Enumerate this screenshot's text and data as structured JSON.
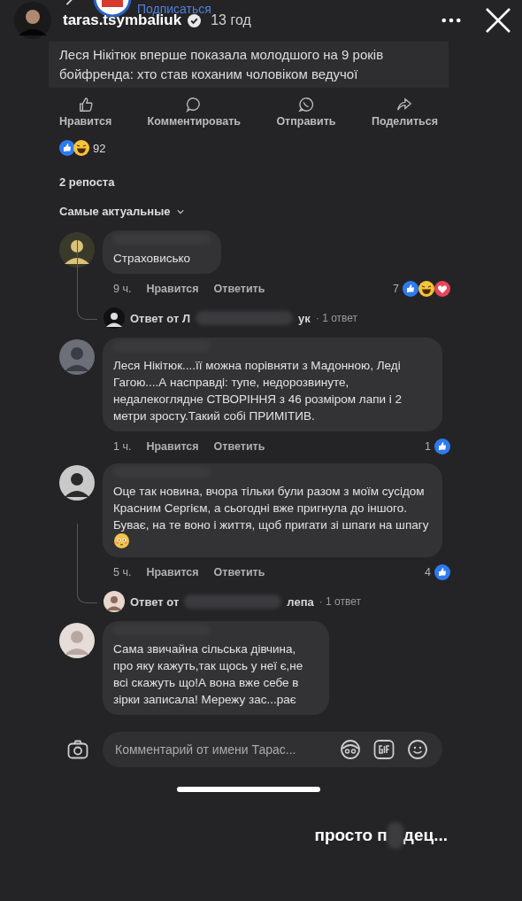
{
  "story": {
    "username": "taras.tsymbaliuk",
    "verified": true,
    "time": "13 год",
    "subscribe": "Подписаться"
  },
  "post": {
    "title": "Леся Нікітюк вперше показала молодшого на 9 років бойфренда: хто став коханим чоловіком ведучої",
    "actions": [
      {
        "kind": "like",
        "label": "Нравится"
      },
      {
        "kind": "comment",
        "label": "Комментировать"
      },
      {
        "kind": "send",
        "label": "Отправить"
      },
      {
        "kind": "share",
        "label": "Поделиться"
      }
    ],
    "reactions": [
      {
        "kind": "like"
      },
      {
        "kind": "haha"
      }
    ],
    "reactions_count": "92",
    "reposts": "2 репоста",
    "sort": "Самые актуальные"
  },
  "comments": [
    {
      "text": "Страховисько",
      "time": "9 ч.",
      "like": "Нравится",
      "reply": "Ответить",
      "count": "7",
      "reactions": [
        {
          "kind": "like"
        },
        {
          "kind": "haha"
        },
        {
          "kind": "love"
        }
      ],
      "replies": {
        "before": "Ответ от Л",
        "after": "ук",
        "count": "· 1 ответ"
      }
    },
    {
      "text": "Леся Нікітюк....її можна порівняти з Мадонною, Леді Гагою....А насправді: тупе, недорозвинуте, недалекоглядне СТВОРІННЯ з 46 розміром лапи і 2 метри зросту.Такий собі ПРИМІТИВ.",
      "time": "1 ч.",
      "like": "Нравится",
      "reply": "Ответить",
      "count": "1",
      "reactions": [
        {
          "kind": "like"
        }
      ]
    },
    {
      "text": "Оце так новина, вчора тільки були разом з моїм сусідом Красним Сергієм, а сьогодні вже пригнула до іншого. Буває, на те воно і життя, щоб пригати зі шпаги на шпагу",
      "emoji": {
        "kind": "flushed"
      },
      "time": "5 ч.",
      "like": "Нравится",
      "reply": "Ответить",
      "count": "4",
      "reactions": [
        {
          "kind": "like"
        }
      ],
      "replies": {
        "before": "Ответ от",
        "after": "лепа",
        "count": "· 1 ответ"
      }
    },
    {
      "text": "Сама звичайна сільська дівчина, про яку кажуть,так щось у неї є,не всі скажуть що!А вона вже себе в зірки записала! Мережу зас...рає",
      "narrow": true
    }
  ],
  "composer": {
    "placeholder": "Комментарий от имени Тарас..."
  },
  "caption": {
    "before": "просто п",
    "after": "дец..."
  }
}
